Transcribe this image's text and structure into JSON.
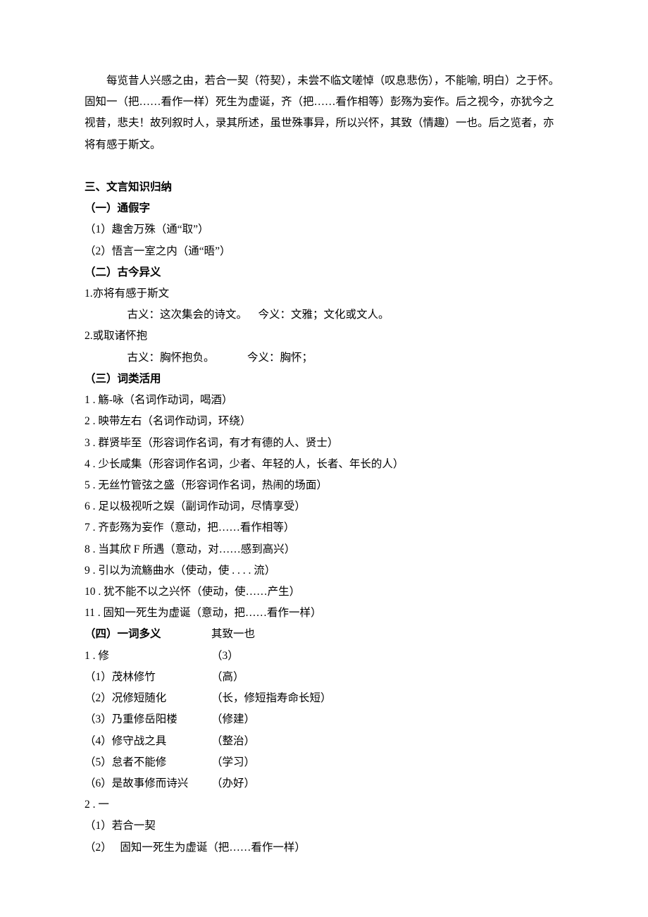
{
  "intro": {
    "p1": "每览昔人兴感之由，若合一契（符契），未尝不临文嗟悼（叹息悲伤），不能喻, 明白）之于怀。固知一（把……看作一样）死生为虚诞，齐（把……看作相等）彭殇为妄作。后之视今，亦犹今之视昔，悲夫！故列叙时人，录其所述，虽世殊事异，所以兴怀，其致（情趣）一也。后之览者，亦将有感于斯文。"
  },
  "s3": {
    "title": "三、文言知识归纳",
    "s1": {
      "title": "（一）通假字",
      "i1": "（1）趣舍万殊（通“取”）",
      "i2": "（2）悟言一室之内（通“晤”）"
    },
    "s2": {
      "title": "（二）古今异义",
      "i1": {
        "head": "1.亦将有感于斯文",
        "gu": "古义：这次集会的诗文。",
        "jin": "今义：文雅；文化或文人。"
      },
      "i2": {
        "head": "2.或取诸怀抱",
        "gu": "古义：胸怀抱负。",
        "jin": "今义：胸怀；"
      }
    },
    "s3": {
      "title": "（三）词类活用",
      "items": [
        "1 . 觞-咏（名词作动词，喝酒）",
        "2 . 映带左右（名词作动词，环绕）",
        "3 . 群贤毕至（形容词作名词，有才有德的人、贤士）",
        "4 . 少长咸集（形容词作名词，少者、年轻的人，长者、年长的人）",
        "5 . 无丝竹管弦之盛（形容词作名词，热闹的场面）",
        "6 . 足以极视听之娱（副词作动词，尽情享受）",
        "7 . 齐彭殇为妄作（意动，把……看作相等）",
        "8 . 当其欣 F 所遇（意动，对……感到高兴）",
        "9 . 引以为流觞曲水（使动，使 . . . . 流）",
        "10 . 犹不能不以之兴怀（使动，使……产生）",
        "11 . 固知一死生为虚诞（意动，把……看作一样）"
      ]
    },
    "s4": {
      "title": "（四）一词多义",
      "g1": {
        "head": "1 . 修",
        "colA": [
          "（1）茂林修竹",
          "（2）况修短随化",
          "（3）乃重修岳阳楼",
          "（4）修守战之具",
          "（5）怠者不能修",
          "（6）是故事修而诗兴"
        ],
        "colB_top": [
          "其致一也",
          "（3）"
        ],
        "colB": [
          "（高）",
          "（长，修短指寿命长短）",
          "（修建）",
          "（整治）",
          "（学习）",
          "（办好）"
        ]
      },
      "g2": {
        "head": "2 . 一",
        "i1": "（1）若合一契",
        "i2_a": "（2）",
        "i2_b": "固知一死生为虚诞（把……看作一样）"
      }
    }
  }
}
